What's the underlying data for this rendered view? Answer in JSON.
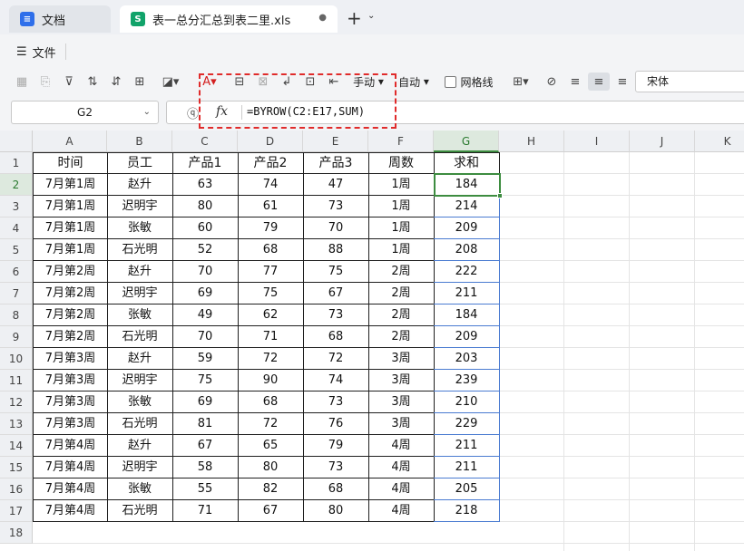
{
  "tabs": [
    {
      "label": "文档",
      "icon": "docs-icon"
    },
    {
      "label": "表一总分汇总到表二里.xls",
      "icon": "spreadsheet-icon"
    }
  ],
  "new_tab_symbol": "+",
  "menu": {
    "file_label": "文件"
  },
  "toolbar": {
    "wrap_label": "手动",
    "auto_label": "自动",
    "gridlines_label": "网格线",
    "font_name": "宋体"
  },
  "formula_bar": {
    "cell_ref": "G2",
    "fx": "fx",
    "formula": "=BYROW(C2:E17,SUM)"
  },
  "sheet": {
    "columns": [
      "A",
      "B",
      "C",
      "D",
      "E",
      "F",
      "G",
      "H",
      "I",
      "J",
      "K"
    ],
    "rows": [
      "1",
      "2",
      "3",
      "4",
      "5",
      "6",
      "7",
      "8",
      "9",
      "10",
      "11",
      "12",
      "13",
      "14",
      "15",
      "16",
      "17",
      "18"
    ],
    "header": [
      "时间",
      "员工",
      "产品1",
      "产品2",
      "产品3",
      "周数",
      "求和"
    ],
    "data": [
      [
        "7月第1周",
        "赵升",
        "63",
        "74",
        "47",
        "1周",
        "184"
      ],
      [
        "7月第1周",
        "迟明宇",
        "80",
        "61",
        "73",
        "1周",
        "214"
      ],
      [
        "7月第1周",
        "张敏",
        "60",
        "79",
        "70",
        "1周",
        "209"
      ],
      [
        "7月第1周",
        "石光明",
        "52",
        "68",
        "88",
        "1周",
        "208"
      ],
      [
        "7月第2周",
        "赵升",
        "70",
        "77",
        "75",
        "2周",
        "222"
      ],
      [
        "7月第2周",
        "迟明宇",
        "69",
        "75",
        "67",
        "2周",
        "211"
      ],
      [
        "7月第2周",
        "张敏",
        "49",
        "62",
        "73",
        "2周",
        "184"
      ],
      [
        "7月第2周",
        "石光明",
        "70",
        "71",
        "68",
        "2周",
        "209"
      ],
      [
        "7月第3周",
        "赵升",
        "59",
        "72",
        "72",
        "3周",
        "203"
      ],
      [
        "7月第3周",
        "迟明宇",
        "75",
        "90",
        "74",
        "3周",
        "239"
      ],
      [
        "7月第3周",
        "张敏",
        "69",
        "68",
        "73",
        "3周",
        "210"
      ],
      [
        "7月第3周",
        "石光明",
        "81",
        "72",
        "76",
        "3周",
        "229"
      ],
      [
        "7月第4周",
        "赵升",
        "67",
        "65",
        "79",
        "4周",
        "211"
      ],
      [
        "7月第4周",
        "迟明宇",
        "58",
        "80",
        "73",
        "4周",
        "211"
      ],
      [
        "7月第4周",
        "张敏",
        "55",
        "82",
        "68",
        "4周",
        "205"
      ],
      [
        "7月第4周",
        "石光明",
        "71",
        "67",
        "80",
        "4周",
        "218"
      ]
    ],
    "selected_column": "G",
    "selected_row": "2"
  },
  "colors": {
    "accent_green": "#3d8c40",
    "highlight_red": "#e02b2b",
    "selection_blue": "#4a7bd1"
  }
}
